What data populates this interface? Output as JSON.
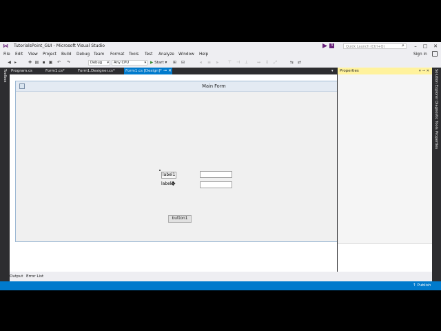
{
  "app": {
    "title": "TutorialsPoint_GUI - Microsoft Visual Studio",
    "notification_count": "3",
    "quick_launch_placeholder": "Quick Launch (Ctrl+Q)",
    "sign_in": "Sign in"
  },
  "menu": [
    "File",
    "Edit",
    "View",
    "Project",
    "Build",
    "Debug",
    "Team",
    "Format",
    "Tools",
    "Test",
    "Analyze",
    "Window",
    "Help"
  ],
  "toolbar": {
    "config": "Debug",
    "platform": "Any CPU",
    "start": "Start"
  },
  "doc_tabs": [
    "Program.cs",
    "Form1.cs*",
    "Form1.Designer.cs*",
    "Form1.cs [Design]*"
  ],
  "side_tabs": {
    "left": "Toolbox",
    "right": [
      "Solution Explorer",
      "Diagnostic Tools",
      "Properties"
    ]
  },
  "form": {
    "title": "Main Form",
    "label1": "label1",
    "label2": "label2",
    "button1": "button1"
  },
  "properties": {
    "title": "Properties"
  },
  "bottom_tabs": [
    "Output",
    "Error List"
  ],
  "status": {
    "publish": "Publish"
  },
  "colors": {
    "accent": "#007acc",
    "chrome": "#2d2d30",
    "vs_purple": "#68217a",
    "properties_header": "#fff29d"
  }
}
